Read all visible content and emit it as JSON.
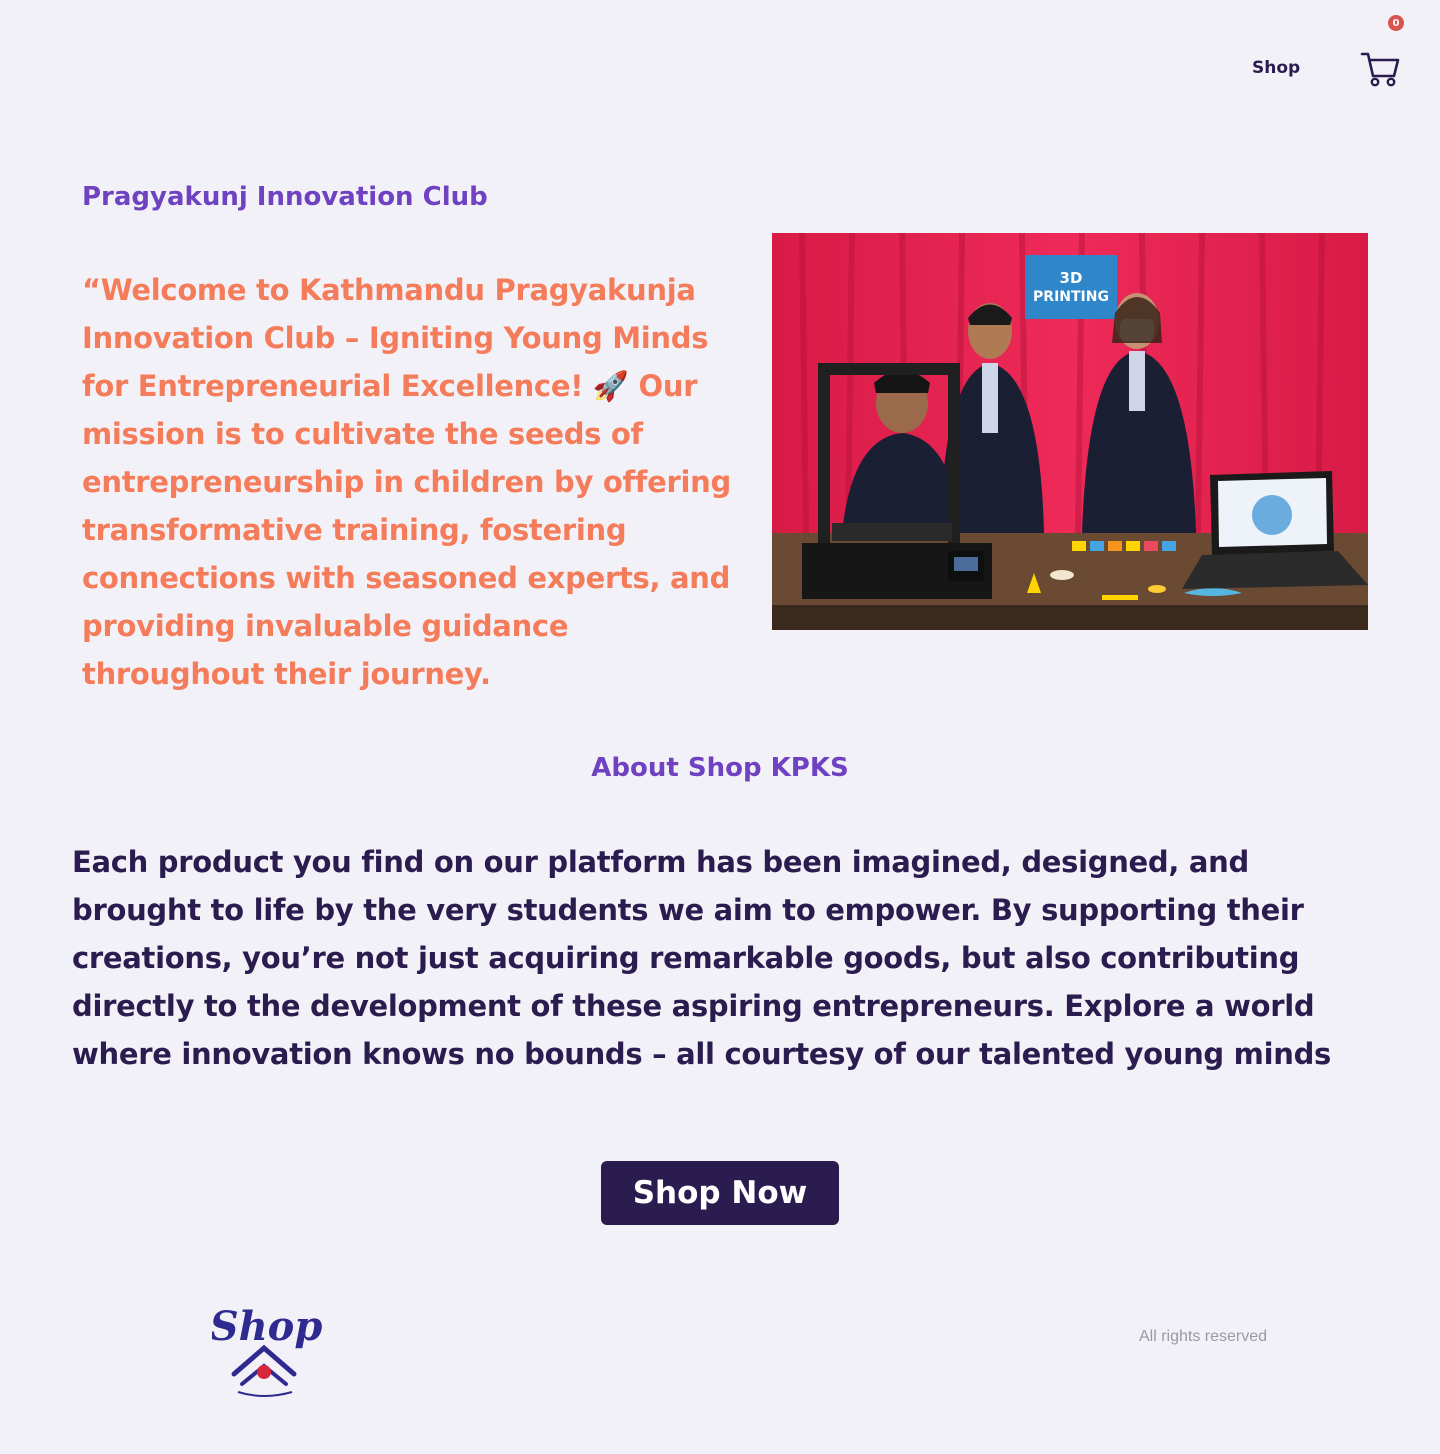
{
  "header": {
    "nav_shop_label": "Shop",
    "cart_count": "0"
  },
  "hero": {
    "club_title": "Pragyakunj Innovation Club",
    "intro_quote": "“Welcome to Kathmandu Pragyakunja Innovation Club – Igniting Young Minds for Entrepreneurial Excellence! 🚀 Our mission is to cultivate the seeds of entrepreneurship in children by offering transformative training, fostering connections with seasoned experts, and providing invaluable guidance throughout their journey.",
    "photo_sign_line1": "3D",
    "photo_sign_line2": "PRINTING"
  },
  "about": {
    "title": "About Shop KPKS",
    "body": "Each product you find on our platform has been imagined, designed, and brought to life by the very students we aim to empower. By supporting their creations, you’re not just acquiring remarkable goods, but also contributing directly to the development of these aspiring entrepreneurs. Explore a world where innovation knows no bounds – all courtesy of our talented young minds",
    "cta_label": "Shop Now"
  },
  "footer": {
    "logo_text": "Shop",
    "rights_text": "All rights reserved"
  },
  "colors": {
    "background": "#f3f1f8",
    "accent_purple": "#6f42c1",
    "accent_coral": "#f47c5a",
    "dark_navy": "#2b1c4f",
    "badge_red": "#d9534f"
  }
}
